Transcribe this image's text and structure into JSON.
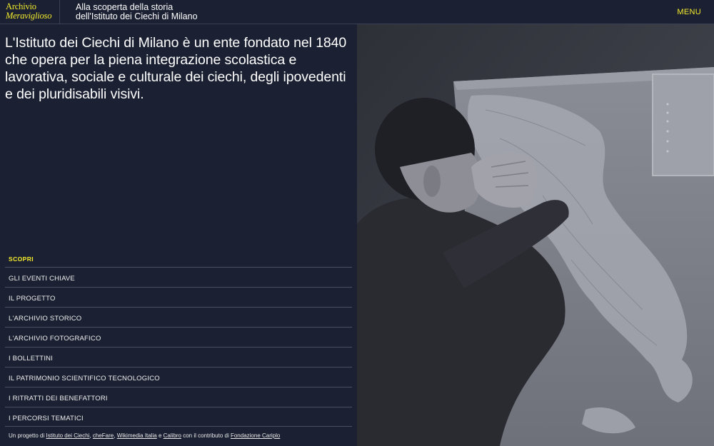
{
  "header": {
    "logo_line1": "Archivio",
    "logo_line2": "Meraviglioso",
    "tagline_line1": "Alla scoperta della storia",
    "tagline_line2": "dell'Istituto dei Ciechi di Milano",
    "menu_label": "MENU"
  },
  "intro": {
    "text": "L'Istituto dei Ciechi di Milano è un ente fondato nel 1840 che opera per la piena integrazione scolastica e lavorativa, sociale e culturale dei ciechi, degli ipovedenti e dei pluridisabili visivi."
  },
  "nav": {
    "heading": "SCOPRI",
    "items": [
      "GLI EVENTI CHIAVE",
      "IL PROGETTO",
      "L'ARCHIVIO STORICO",
      "L'ARCHIVIO FOTOGRAFICO",
      "I BOLLETTINI",
      "IL PATRIMONIO SCIENTIFICO TECNOLOGICO",
      "I RITRATTI DEI BENEFATTORI",
      "I PERCORSI TEMATICI"
    ]
  },
  "footer": {
    "prefix": "Un progetto di",
    "link1": "Istituto dei Ciechi",
    "sep1": ",",
    "link2": "cheFare",
    "sep2": ",",
    "link3": "Wikimedia Italia",
    "and": "e",
    "link4": "Calibro",
    "middle": "con il contributo di",
    "link5": "Fondazione Cariplo"
  },
  "colors": {
    "background": "#1b2133",
    "accent": "#f3ea2b"
  }
}
